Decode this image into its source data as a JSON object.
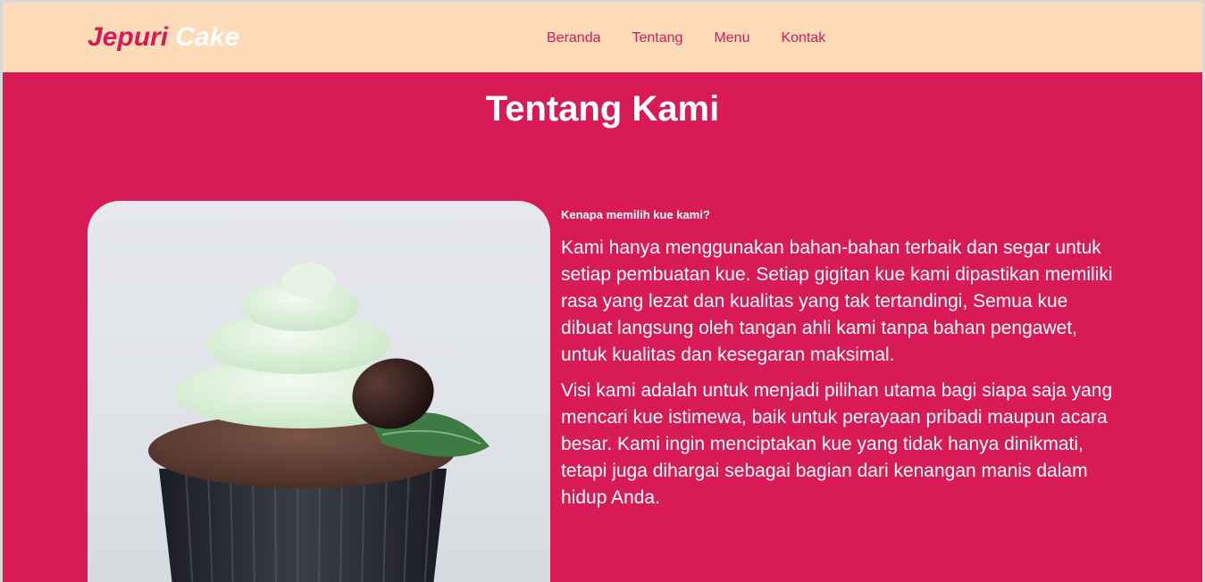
{
  "brand": {
    "part1": "Jepuri",
    "part2": "Cake"
  },
  "nav": {
    "items": [
      {
        "label": "Beranda"
      },
      {
        "label": "Tentang"
      },
      {
        "label": "Menu"
      },
      {
        "label": "Kontak"
      }
    ]
  },
  "about": {
    "title": "Tentang Kami",
    "question": "Kenapa memilih kue kami?",
    "paragraphs": [
      "Kami hanya menggunakan bahan-bahan terbaik dan segar untuk setiap pembuatan kue. Setiap gigitan kue kami dipastikan memiliki rasa yang lezat dan kualitas yang tak tertandingi, Semua kue dibuat langsung oleh tangan ahli kami tanpa bahan pengawet, untuk kualitas dan kesegaran maksimal.",
      "Visi kami adalah untuk menjadi pilihan utama bagi siapa saja yang mencari kue istimewa, baik untuk perayaan pribadi maupun acara besar. Kami ingin menciptakan kue yang tidak hanya dinikmati, tetapi juga dihargai sebagai bagian dari kenangan manis dalam hidup Anda."
    ]
  },
  "colors": {
    "primary": "#d81a57",
    "navbar_bg": "#fedbb9",
    "text_light": "#ffffff"
  }
}
